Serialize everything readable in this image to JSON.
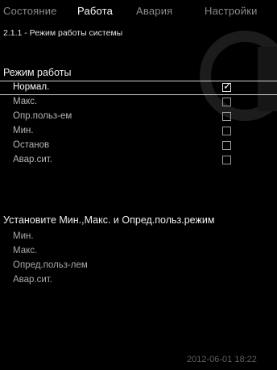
{
  "tabs": [
    "Состояние",
    "Работа",
    "Авария",
    "Настройки"
  ],
  "active_tab": "Работа",
  "breadcrumb": "2.1.1 - Режим работы системы",
  "mode_section": {
    "title": "Режим работы",
    "options": [
      {
        "label": "Нормал.",
        "checked": true
      },
      {
        "label": "Макс.",
        "checked": false
      },
      {
        "label": "Опр.польз-ем",
        "checked": false
      },
      {
        "label": "Мин.",
        "checked": false
      },
      {
        "label": "Останов",
        "checked": false
      },
      {
        "label": "Авар.сит.",
        "checked": false
      }
    ]
  },
  "settings_section": {
    "title": "Установите Мин.,Макс. и Опред.польз.режим",
    "items": [
      "Мин.",
      "Макс.",
      "Опред.польз-лем",
      "Авар.сит."
    ]
  },
  "checkmark_glyph": "✓",
  "datetime": "2012-06-01 18:22",
  "colors": {
    "background": "#000000",
    "active_tab": "#ffffff",
    "inactive_tab": "#8a8a8a"
  }
}
